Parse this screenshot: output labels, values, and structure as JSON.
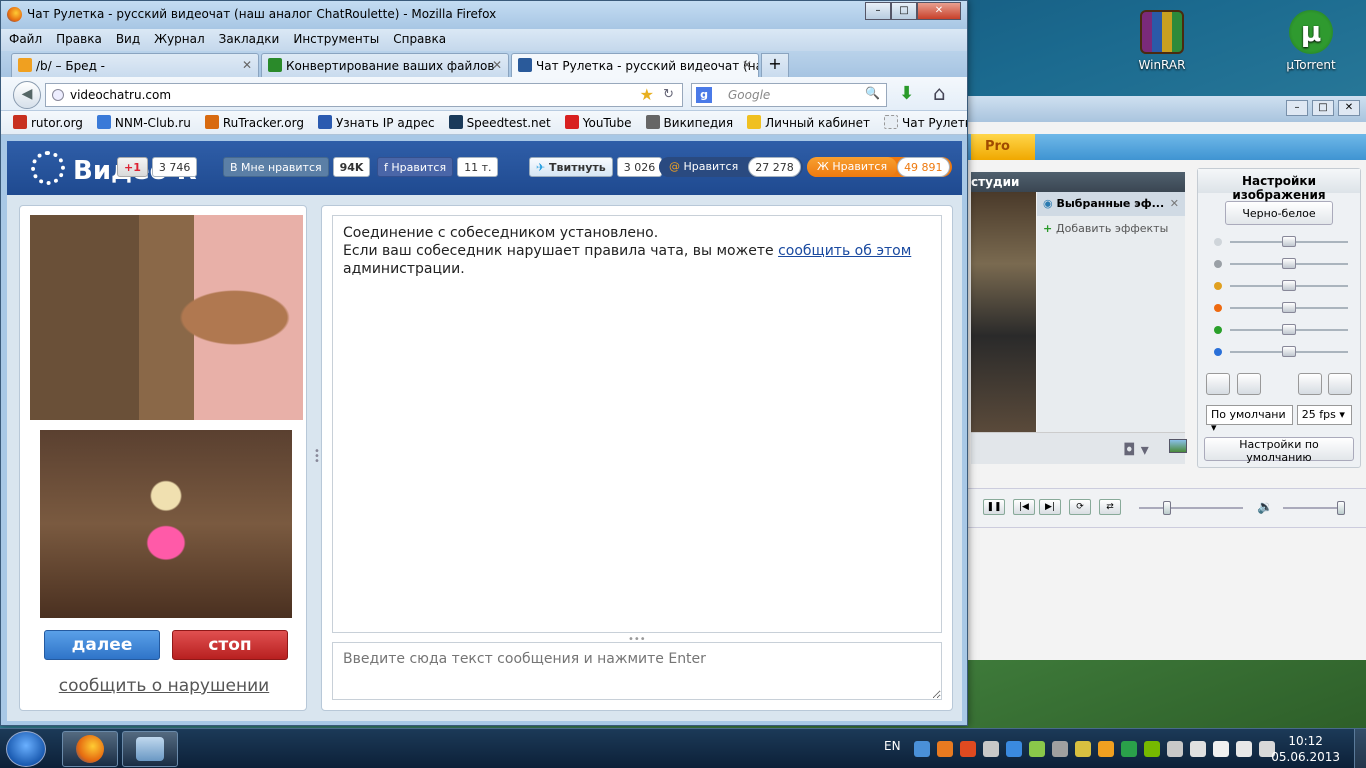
{
  "desktop": {
    "icons": [
      {
        "label": "WinRAR"
      },
      {
        "label": "µTorrent"
      }
    ]
  },
  "bg_app": {
    "pro_tab": "Pro",
    "studio_header": "студии",
    "effects_selected": "Выбранные эф...",
    "effects_add": "Добавить эффекты",
    "image_settings_title": "Настройки изображения",
    "bw_button": "Черно-белое",
    "preset_select": "По умолчани",
    "fps_select": "25 fps",
    "defaults_button": "Настройки по умолчанию",
    "slider_colors": [
      "#cfd5da",
      "#9aa0a6",
      "#e0a020",
      "#ee6a10",
      "#2aa02a",
      "#2a70d8"
    ]
  },
  "browser": {
    "title": "Чат Рулетка - русский видеочат (наш аналог ChatRoulette) - Mozilla Firefox",
    "menu": [
      "Файл",
      "Правка",
      "Вид",
      "Журнал",
      "Закладки",
      "Инструменты",
      "Справка"
    ],
    "tabs": [
      {
        "label": "/b/ – Бред -",
        "active": false,
        "color": "#f0a020"
      },
      {
        "label": "Конвертирование ваших файлов",
        "active": false,
        "color": "#2a8a2a"
      },
      {
        "label": "Чат Рулетка - русский видеочат (на...",
        "active": true,
        "color": "#2a5a9a"
      }
    ],
    "url": "videochatru.com",
    "search_placeholder": "Google",
    "bookmarks": [
      {
        "label": "rutor.org",
        "color": "#c83020"
      },
      {
        "label": "NNM-Club.ru",
        "color": "#3a7ad8"
      },
      {
        "label": "RuTracker.org",
        "color": "#d86a10"
      },
      {
        "label": "Узнать IP адрес",
        "color": "#2a5ab0"
      },
      {
        "label": "Speedtest.net",
        "color": "#1a3a5a"
      },
      {
        "label": "YouTube",
        "color": "#d82020"
      },
      {
        "label": "Википедия",
        "color": "#666666"
      },
      {
        "label": "Личный кабинет",
        "color": "#f0c020"
      },
      {
        "label": "Чат Рулетка - русски...",
        "color": "#e8eef4"
      }
    ]
  },
  "site": {
    "logo_text": "Видео R",
    "social": {
      "gplus_label": "+1",
      "gplus_count": "3 746",
      "vk_label": "Мне нравится",
      "vk_count": "94K",
      "fb_label": "Нравится",
      "fb_count": "11 т.",
      "tw_label": "Твитнуть",
      "tw_count": "3 026",
      "mail_label": "Нравится",
      "mail_count": "27 278",
      "ok_label": "Нравится",
      "ok_count": "49 891"
    },
    "buttons": {
      "next": "далее",
      "stop": "стоп"
    },
    "report_link": "сообщить о нарушении",
    "chat": {
      "line1": "Соединение с собеседником установлено.",
      "line2_pre": "Если ваш собеседник нарушает правила чата, вы можете ",
      "line2_link": "сообщить об этом",
      "line3": "администрации."
    },
    "input_placeholder": "Введите сюда текст сообщения и нажмите Enter"
  },
  "taskbar": {
    "lang": "EN",
    "time": "10:12",
    "date": "05.06.2013",
    "tray_colors": [
      "#4a90d8",
      "#e87a20",
      "#e04a20",
      "#c8c8c8",
      "#3a8ae0",
      "#8ac84a",
      "#a0a0a0",
      "#d8c040",
      "#f0a020",
      "#2aa04a",
      "#76b900",
      "#c8c8c8",
      "#e0e0e0",
      "#f0f0f0",
      "#e8e8e8",
      "#d8d8d8"
    ]
  }
}
